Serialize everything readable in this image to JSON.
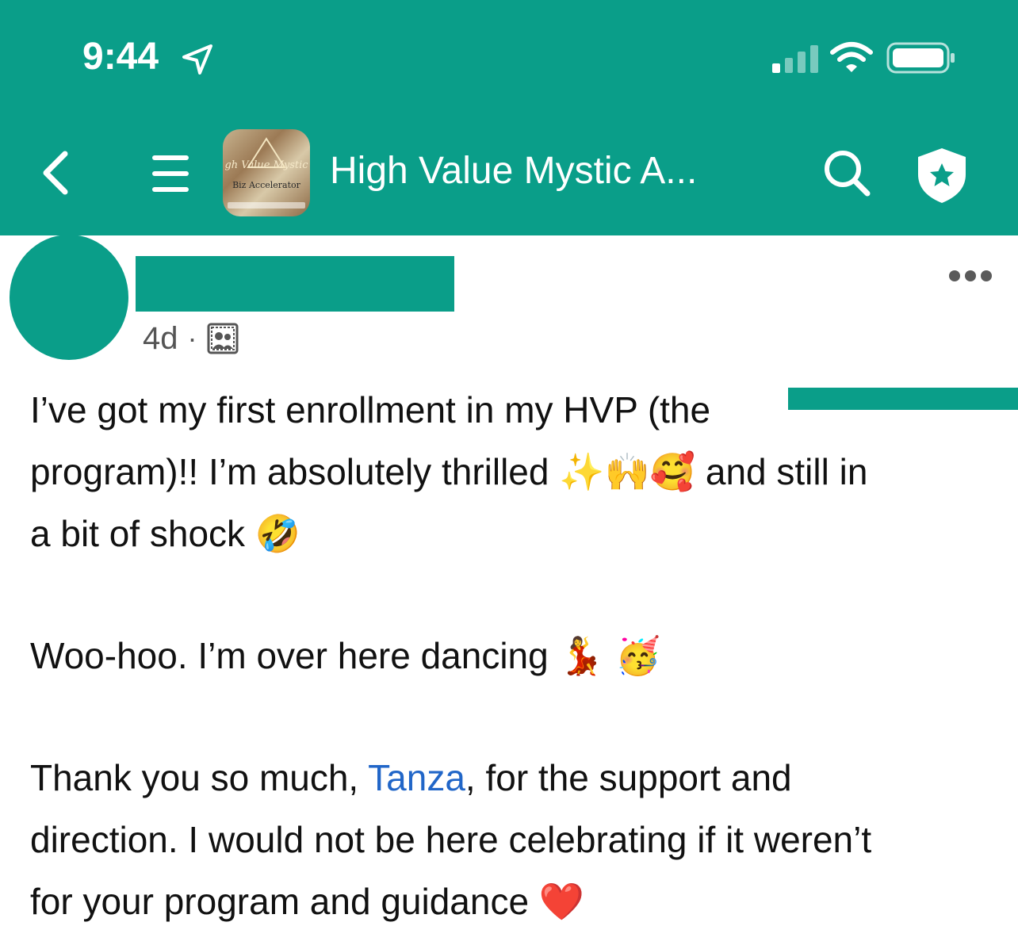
{
  "status_bar": {
    "time": "9:44",
    "location_icon": "location-arrow-icon",
    "signal_icon": "cellular-signal-icon",
    "wifi_icon": "wifi-icon",
    "battery_icon": "battery-icon"
  },
  "header": {
    "back_icon": "chevron-left-icon",
    "menu_icon": "hamburger-menu-icon",
    "group_avatar_text_1": "gh Value Mystic",
    "group_avatar_text_2": "Biz Accelerator",
    "title": "High Value Mystic A...",
    "search_icon": "search-icon",
    "admin_icon": "shield-star-icon",
    "background_color": "#0a9e89"
  },
  "post": {
    "time_ago": "4d",
    "separator": "·",
    "privacy_icon": "members-only-group-icon",
    "more_icon": "more-horizontal-icon",
    "paragraphs": {
      "p1": {
        "line1": "I’ve got my first enrollment in my HVP (the",
        "line2_a": "program)!! I’m absolutely thrilled",
        "line2_emojis": "✨🙌🥰",
        "line2_b": "and still in",
        "line3_a": "a bit of shock",
        "line3_emoji": "🤣"
      },
      "p2": {
        "text": "Woo-hoo. I’m over here dancing",
        "emojis": "💃 🥳"
      },
      "p3": {
        "line1_a": "Thank you so much, ",
        "mention": "Tanza",
        "line1_b": ", for the support and",
        "line2": "direction. I would not be here celebrating if it weren’t",
        "line3_a": "for your program and guidance",
        "line3_emoji": "❤️"
      }
    },
    "mention_color": "#2166c8"
  }
}
